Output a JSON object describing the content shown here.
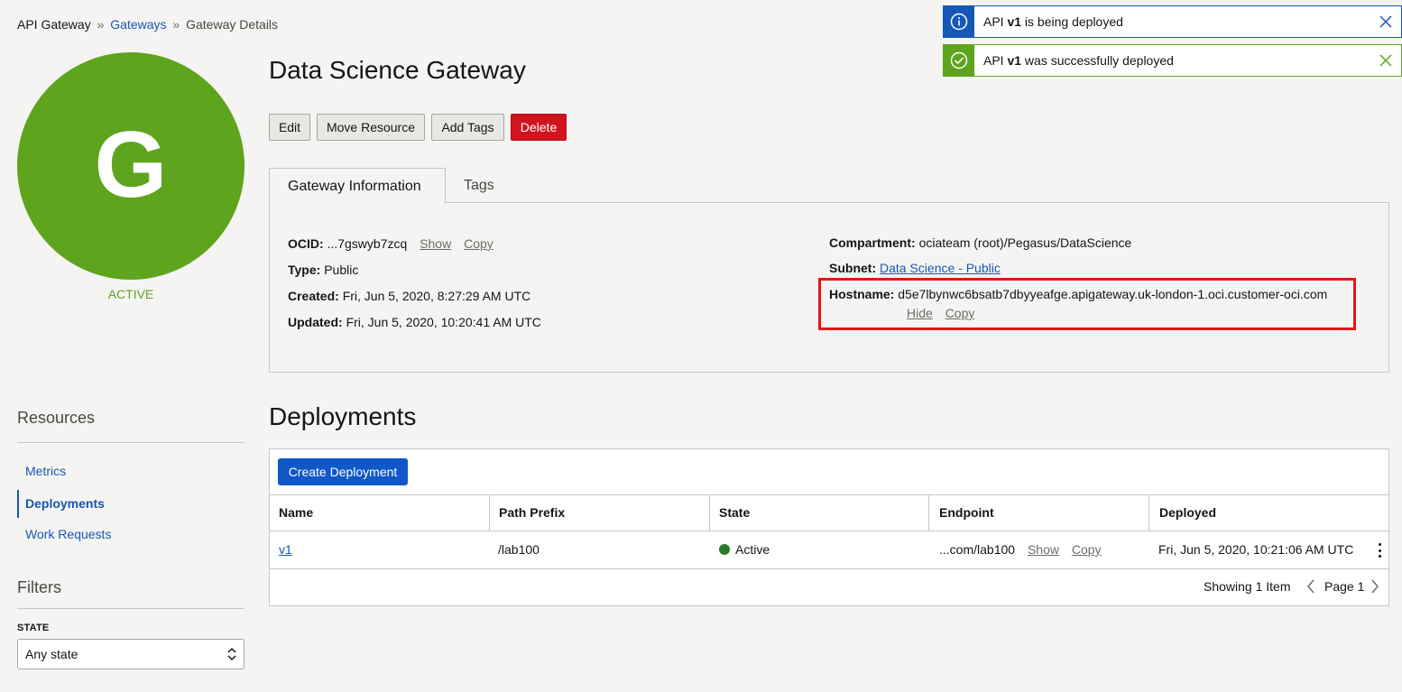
{
  "breadcrumb": {
    "root": "API Gateway",
    "separator": "»",
    "parent": "Gateways",
    "current": "Gateway Details"
  },
  "avatar": {
    "letter": "G",
    "status": "ACTIVE",
    "color": "#5ea41d"
  },
  "title": "Data Science Gateway",
  "actions": {
    "edit": "Edit",
    "move": "Move Resource",
    "add_tags": "Add Tags",
    "delete": "Delete"
  },
  "tabs": {
    "info": "Gateway Information",
    "tags": "Tags"
  },
  "info": {
    "ocid_label": "OCID:",
    "ocid_value": "...7gswyb7zcq",
    "ocid_show": "Show",
    "ocid_copy": "Copy",
    "type_label": "Type:",
    "type_value": "Public",
    "created_label": "Created:",
    "created_value": "Fri, Jun 5, 2020, 8:27:29 AM UTC",
    "updated_label": "Updated:",
    "updated_value": "Fri, Jun 5, 2020, 10:20:41 AM UTC",
    "compartment_label": "Compartment:",
    "compartment_value": "ociateam (root)/Pegasus/DataScience",
    "subnet_label": "Subnet:",
    "subnet_value": "Data Science - Public",
    "hostname_label": "Hostname:",
    "hostname_value": "d5e7lbynwc6bsatb7dbyyeafge.apigateway.uk-london-1.oci.customer-oci.com",
    "hostname_hide": "Hide",
    "hostname_copy": "Copy"
  },
  "resources": {
    "heading": "Resources",
    "items": [
      {
        "label": "Metrics"
      },
      {
        "label": "Deployments",
        "active": true
      },
      {
        "label": "Work Requests"
      }
    ]
  },
  "filters": {
    "heading": "Filters",
    "state_label": "STATE",
    "state_value": "Any state"
  },
  "deployments": {
    "heading": "Deployments",
    "create_label": "Create Deployment",
    "columns": [
      "Name",
      "Path Prefix",
      "State",
      "Endpoint",
      "Deployed"
    ],
    "rows": [
      {
        "name": "v1",
        "path_prefix": "/lab100",
        "state": "Active",
        "endpoint": "...com/lab100",
        "endpoint_show": "Show",
        "endpoint_copy": "Copy",
        "deployed": "Fri, Jun 5, 2020, 10:21:06 AM UTC"
      }
    ],
    "showing": "Showing 1 Item",
    "page": "Page 1"
  },
  "toasts": [
    {
      "prefix": "API ",
      "bold": "v1",
      "suffix": " is being deployed",
      "kind": "info",
      "color": "#1658b5"
    },
    {
      "prefix": "API ",
      "bold": "v1",
      "suffix": " was successfully deployed",
      "kind": "success",
      "color": "#5ea41d"
    }
  ]
}
